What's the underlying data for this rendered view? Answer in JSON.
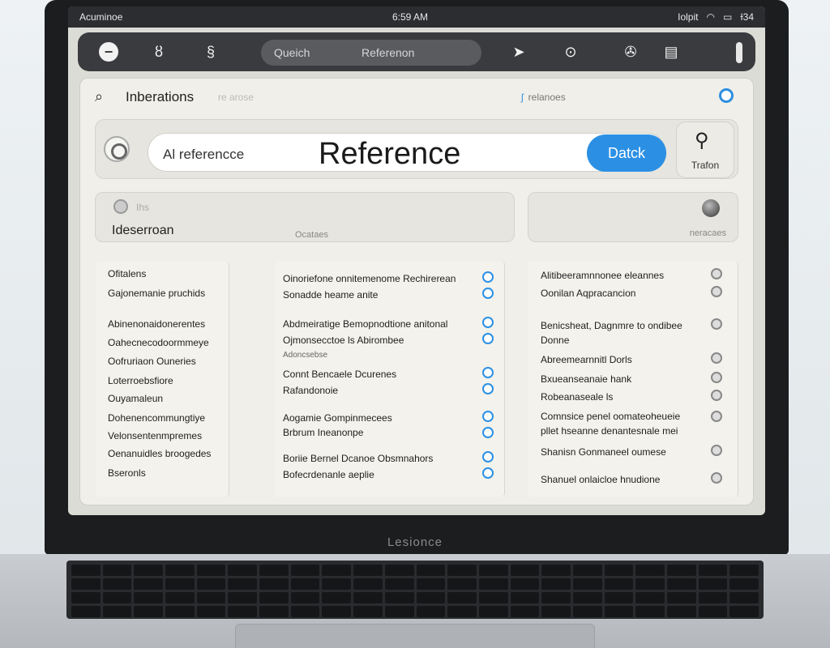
{
  "status_bar": {
    "app": "Acuminoe",
    "time": "6:59 AM",
    "right": [
      "Iolpit",
      "Ɨ34"
    ]
  },
  "toolbar": {
    "search_left": "Queich",
    "search_right": "Referenon"
  },
  "window": {
    "title": "Inberations",
    "title_ghost": "re arose",
    "link": "relanoes",
    "search_value": "Al referencce",
    "search_big": "Reference",
    "button": "Datck",
    "side_label": "Trafon"
  },
  "filter": {
    "small": "Ihs",
    "label": "Ideserroan",
    "mid": "Ocataes",
    "right_label": "neracaes"
  },
  "columns": {
    "col1": [
      "Ofitalens",
      "Gajonemanie pruchids",
      "Abinenonaidonerentes",
      "Oahecnecodoormmeye",
      "Oofruriaon Ouneries",
      "Loterroebsfiore",
      "Ouyamaleun",
      "Dohenencommungtiye",
      "Velonsentenmpremes",
      "Oenanuidles broogedes",
      "Bseronls"
    ],
    "col2": [
      {
        "t": "Oinoriefone onnitemenome Rechirerean",
        "s": "Sonadde heame anite"
      },
      {
        "t": "Abdmeiratige Bemopnodtione anitonal",
        "s": "Ojmonsecctoe ls Abirombee",
        "n": "Adoncsebse"
      },
      {
        "t": "Connt Bencaele Dcurenes",
        "s": "Rafandonoie"
      },
      {
        "t": "Aogamie Gompinmecees",
        "s": "Brbrum Ineanonpe"
      },
      {
        "t": "Boriie Bernel Dcanoe Obsmnahors",
        "s": "Bofecrdenanle aeplie"
      }
    ],
    "col3": [
      {
        "t": "Alitibeeramnnonee eleannes",
        "s": "Oonilan Aqpracancion"
      },
      {
        "t": "Benicsheat, Dagnmre to ondibee",
        "s": "Donne"
      },
      {
        "t": "Abreemearnnitl Dorls"
      },
      {
        "t": "Bxueanseanaie hank"
      },
      {
        "t": "Robeanaseale ls"
      },
      {
        "t": "Comnsice penel oomateoheueie",
        "s": "pllet hseanne denantesnale mei"
      },
      {
        "t": "Shanisn Gonmaneel oumese"
      },
      {
        "t": "Shanuel onlaicloe hnudione"
      }
    ]
  },
  "brand": "Lesionce"
}
